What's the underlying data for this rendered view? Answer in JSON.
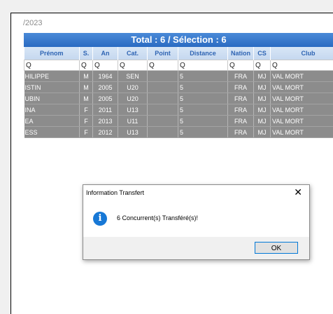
{
  "header": {
    "date_fragment": "/2023",
    "banner": "Total : 6 / Sélection : 6"
  },
  "table": {
    "columns": [
      "Prénom",
      "S.",
      "An",
      "Cat.",
      "Point",
      "Distance",
      "Nation",
      "CS",
      "Club"
    ],
    "search_icon": "magnifier-icon",
    "rows": [
      [
        "HILIPPE",
        "M",
        "1964",
        "SEN",
        "",
        "5",
        "FRA",
        "MJ",
        "VAL MORT"
      ],
      [
        "ISTIN",
        "M",
        "2005",
        "U20",
        "",
        "5",
        "FRA",
        "MJ",
        "VAL MORT"
      ],
      [
        "UBIN",
        "M",
        "2005",
        "U20",
        "",
        "5",
        "FRA",
        "MJ",
        "VAL MORT"
      ],
      [
        "INA",
        "F",
        "2011",
        "U13",
        "",
        "5",
        "FRA",
        "MJ",
        "VAL MORT"
      ],
      [
        "EA",
        "F",
        "2013",
        "U11",
        "",
        "5",
        "FRA",
        "MJ",
        "VAL MORT"
      ],
      [
        "ESS",
        "F",
        "2012",
        "U13",
        "",
        "5",
        "FRA",
        "MJ",
        "VAL MORT"
      ]
    ]
  },
  "dialog": {
    "title": "Information Transfert",
    "close": "✕",
    "icon": "info-icon",
    "message": "6 Concurrent(s) Transféré(s)!",
    "ok_label": "OK"
  },
  "colors": {
    "banner": "#2f72c9",
    "header_text": "#2e64b3",
    "row_bg": "#8c8c8c"
  }
}
